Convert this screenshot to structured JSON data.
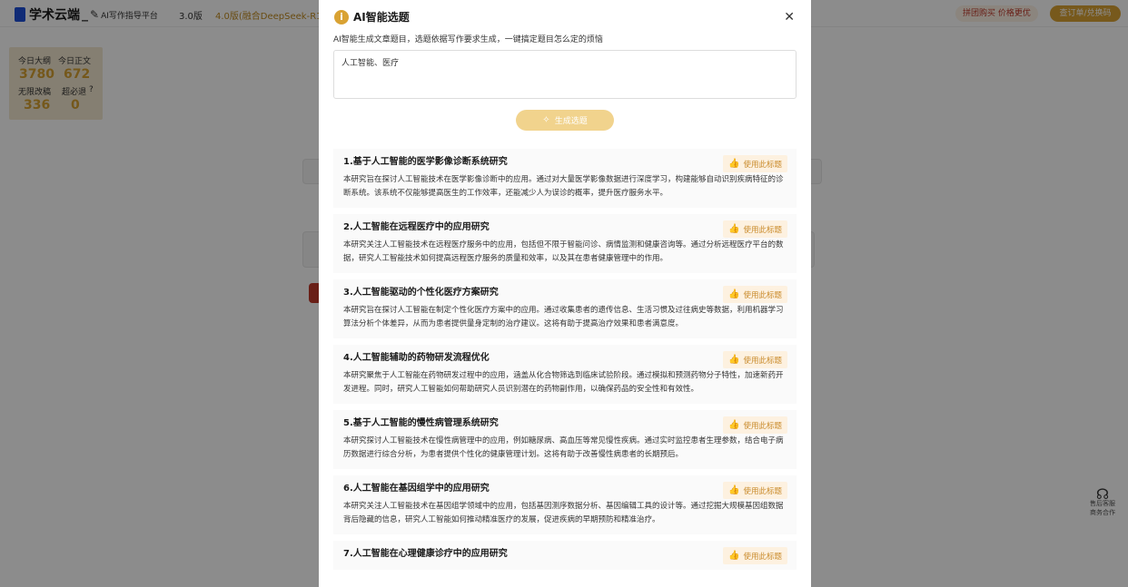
{
  "app": {
    "brand_name": "学术云端",
    "brand_sep": "_",
    "brand_sub": "AI写作指导平台",
    "version_a": "3.0版",
    "version_b": "4.0版(融合DeepSeek-R1)",
    "promo_1": "拼团购买 价格更优",
    "promo_2": "查订单/兑换码",
    "support_label_1": "售后客服",
    "support_label_2": "商务合作"
  },
  "stats": {
    "outline_label": "今日大纲",
    "body_label": "今日正文",
    "outline_value": "3780",
    "body_value": "672",
    "unlimited_label": "无限改稿",
    "refund_label": "超必退",
    "unlimited_value": "336",
    "refund_value": "0"
  },
  "modal": {
    "title": "AI智能选题",
    "description": "AI智能生成文章题目，选题依据写作要求生成，一键搞定题目怎么定的烦恼",
    "input_value": "人工智能、医疗",
    "generate_label": "生成选题",
    "use_label": "使用此标题",
    "results": [
      {
        "title": "1.基于人工智能的医学影像诊断系统研究",
        "body": "本研究旨在探讨人工智能技术在医学影像诊断中的应用。通过对大量医学影像数据进行深度学习，构建能够自动识别疾病特征的诊断系统。该系统不仅能够提高医生的工作效率，还能减少人为误诊的概率，提升医疗服务水平。"
      },
      {
        "title": "2.人工智能在远程医疗中的应用研究",
        "body": "本研究关注人工智能技术在远程医疗服务中的应用，包括但不限于智能问诊、病情监测和健康咨询等。通过分析远程医疗平台的数据，研究人工智能技术如何提高远程医疗服务的质量和效率，以及其在患者健康管理中的作用。"
      },
      {
        "title": "3.人工智能驱动的个性化医疗方案研究",
        "body": "本研究旨在探讨人工智能在制定个性化医疗方案中的应用。通过收集患者的遗传信息、生活习惯及过往病史等数据，利用机器学习算法分析个体差异，从而为患者提供量身定制的治疗建议。这将有助于提高治疗效果和患者满意度。"
      },
      {
        "title": "4.人工智能辅助的药物研发流程优化",
        "body": "本研究聚焦于人工智能在药物研发过程中的应用，涵盖从化合物筛选到临床试验阶段。通过模拟和预测药物分子特性，加速新药开发进程。同时，研究人工智能如何帮助研究人员识别潜在的药物副作用，以确保药品的安全性和有效性。"
      },
      {
        "title": "5.基于人工智能的慢性病管理系统研究",
        "body": "本研究探讨人工智能技术在慢性病管理中的应用，例如糖尿病、高血压等常见慢性疾病。通过实时监控患者生理参数，结合电子病历数据进行综合分析，为患者提供个性化的健康管理计划。这将有助于改善慢性病患者的长期预后。"
      },
      {
        "title": "6.人工智能在基因组学中的应用研究",
        "body": "本研究关注人工智能技术在基因组学领域中的应用，包括基因测序数据分析、基因编辑工具的设计等。通过挖掘大规模基因组数据背后隐藏的信息，研究人工智能如何推动精准医疗的发展，促进疾病的早期预防和精准治疗。"
      },
      {
        "title": "7.人工智能在心理健康诊疗中的应用研究",
        "body": ""
      }
    ]
  }
}
